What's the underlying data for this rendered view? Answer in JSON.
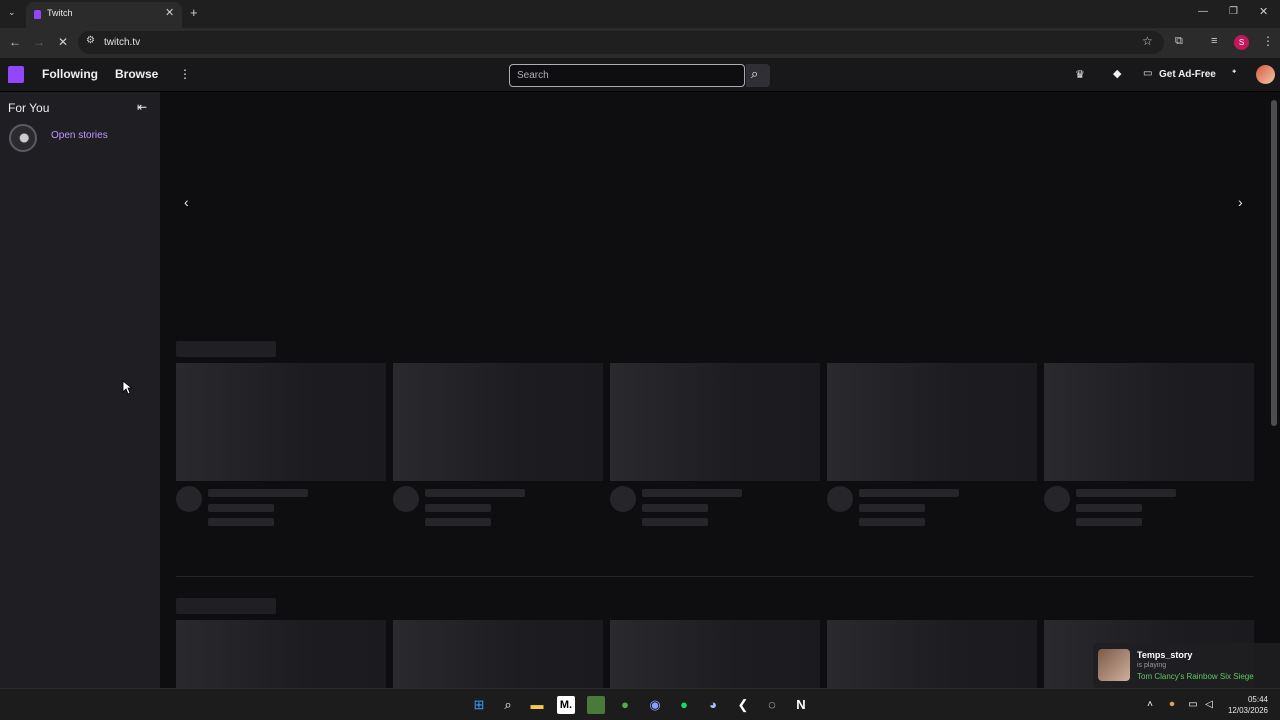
{
  "browser": {
    "tab_title": "Twitch",
    "tab_close": "✕",
    "new_tab": "+",
    "url": "twitch.tv",
    "profile_initial": "S",
    "window_controls": [
      "—",
      "❐",
      "✕"
    ]
  },
  "nav": {
    "following": "Following",
    "browse": "Browse",
    "more": "⋮",
    "search_placeholder": "Search",
    "get_ad_free": "Get Ad-Free"
  },
  "sidebar": {
    "header": "For You",
    "collapse": "⇤",
    "stories_label": "Open stories"
  },
  "main": {
    "carousel_prev": "‹",
    "carousel_next": "›"
  },
  "toast": {
    "name": "Temps_story",
    "status": "is playing",
    "game": "Tom Clancy's Rainbow Six Siege"
  },
  "taskbar": {
    "time": "05:44",
    "date": "12/03/2026"
  },
  "colors": {
    "twitch_purple": "#9146ff",
    "background": "#0e0e10",
    "sidebar": "#1f1f23"
  }
}
